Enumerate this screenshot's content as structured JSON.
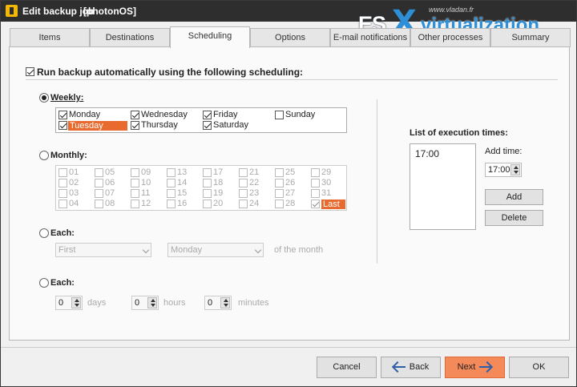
{
  "window": {
    "title": "Edit backup job",
    "job": "[photonOS]"
  },
  "watermark": {
    "es": "ES",
    "x": "X",
    "virt": "virtualization",
    "url": "www.vladan.fr"
  },
  "tabs": [
    "Items",
    "Destinations",
    "Scheduling",
    "Options",
    "E-mail notifications",
    "Other processes",
    "Summary"
  ],
  "active_tab": "Scheduling",
  "run_auto_label": "Run backup automatically using the following scheduling:",
  "weekly": {
    "label": "Weekly:",
    "days": [
      {
        "name": "Monday",
        "checked": true
      },
      {
        "name": "Tuesday",
        "checked": true,
        "highlighted": true
      },
      {
        "name": "Wednesday",
        "checked": true
      },
      {
        "name": "Thursday",
        "checked": true
      },
      {
        "name": "Friday",
        "checked": true
      },
      {
        "name": "Saturday",
        "checked": true
      },
      {
        "name": "Sunday",
        "checked": false
      }
    ]
  },
  "monthly": {
    "label": "Monthly:",
    "days": [
      "01",
      "02",
      "03",
      "04",
      "05",
      "06",
      "07",
      "08",
      "09",
      "10",
      "11",
      "12",
      "13",
      "14",
      "15",
      "16",
      "17",
      "18",
      "19",
      "20",
      "21",
      "22",
      "23",
      "24",
      "25",
      "26",
      "27",
      "28",
      "29",
      "30",
      "31",
      "Last"
    ],
    "checked": [
      "Last"
    ]
  },
  "each1": {
    "label": "Each:",
    "first": "First",
    "day": "Monday",
    "suffix": "of the month"
  },
  "each2": {
    "label": "Each:",
    "days_value": "0",
    "days_label": "days",
    "hours_value": "0",
    "hours_label": "hours",
    "minutes_value": "0",
    "minutes_label": "minutes"
  },
  "execution": {
    "title": "List of execution times:",
    "times": [
      "17:00"
    ],
    "add_time_label": "Add time:",
    "add_time_value": "17:00",
    "add_button": "Add",
    "delete_button": "Delete"
  },
  "footer": {
    "cancel": "Cancel",
    "back": "Back",
    "next": "Next",
    "ok": "OK"
  },
  "colors": {
    "accent": "#e86a2e",
    "primary_button": "#f4895a",
    "titlebar": "#2e2e2e",
    "logo_blue": "#2f8fd6"
  }
}
